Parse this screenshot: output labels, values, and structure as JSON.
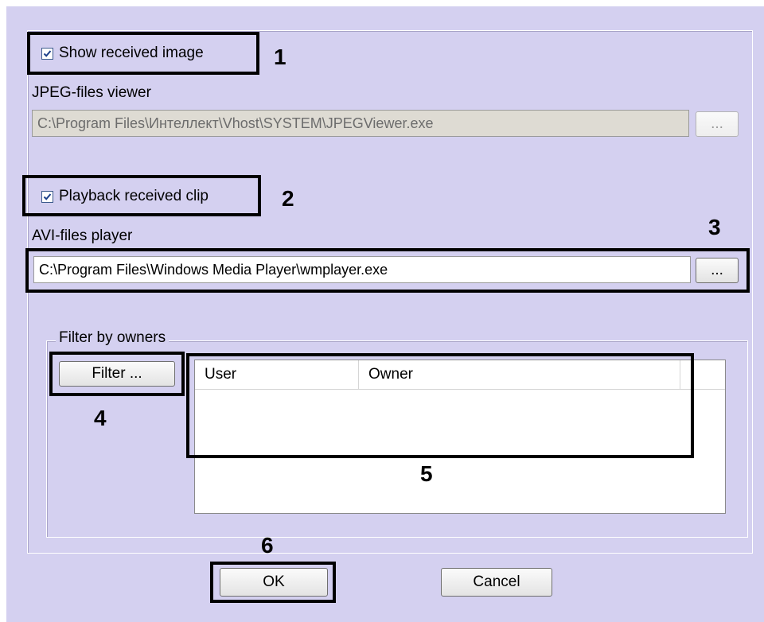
{
  "top_fragments": [
    "...",
    "..."
  ],
  "show_image": {
    "label": "Show received image",
    "checked": true
  },
  "jpeg": {
    "label": "JPEG-files viewer",
    "path": "C:\\Program Files\\Интеллект\\Vhost\\SYSTEM\\JPEGViewer.exe",
    "browse": "..."
  },
  "playback": {
    "label": "Playback received clip",
    "checked": true
  },
  "avi": {
    "label": "AVI-files player",
    "path": "C:\\Program Files\\Windows Media Player\\wmplayer.exe",
    "browse": "..."
  },
  "filter_group": {
    "title": "Filter by owners",
    "button": "Filter ..."
  },
  "table": {
    "columns": [
      "User",
      "Owner"
    ],
    "rows": []
  },
  "buttons": {
    "ok": "OK",
    "cancel": "Cancel"
  },
  "callouts": [
    "1",
    "2",
    "3",
    "4",
    "5",
    "6"
  ]
}
